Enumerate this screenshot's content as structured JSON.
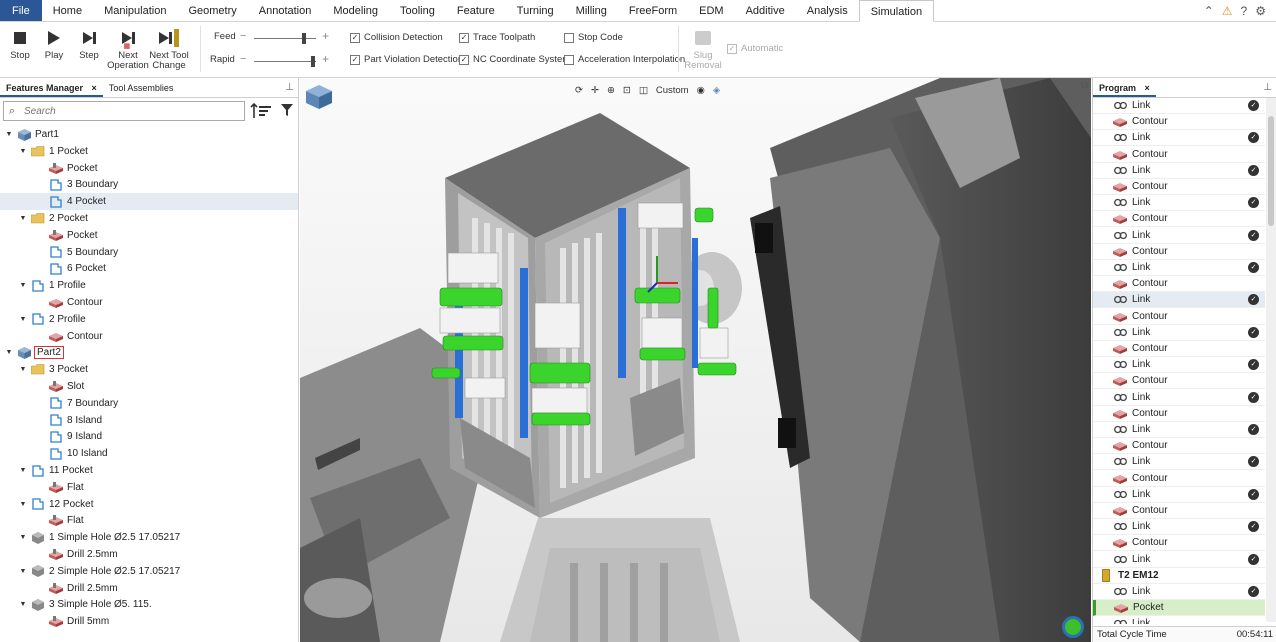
{
  "menu": {
    "file": "File",
    "tabs": [
      "Home",
      "Manipulation",
      "Geometry",
      "Annotation",
      "Modeling",
      "Tooling",
      "Feature",
      "Turning",
      "Milling",
      "FreeForm",
      "EDM",
      "Additive",
      "Analysis",
      "Simulation"
    ],
    "active": "Simulation"
  },
  "ribbon": {
    "stop": "Stop",
    "play": "Play",
    "step": "Step",
    "next_op": "Next Operation",
    "next_tool": "Next Tool Change",
    "feed_label": "Feed",
    "rapid_label": "Rapid",
    "feed_level": 0.78,
    "rapid_level": 0.92,
    "checks": [
      {
        "label": "Collision Detection",
        "checked": true
      },
      {
        "label": "Part Violation Detection",
        "checked": true
      },
      {
        "label": "Trace Toolpath",
        "checked": true
      },
      {
        "label": "NC Coordinate System",
        "checked": true
      },
      {
        "label": "Stop Code",
        "checked": false
      },
      {
        "label": "Acceleration Interpolation",
        "checked": false
      }
    ],
    "slug": "Slug Removal",
    "automatic": "Automatic"
  },
  "left": {
    "tab1": "Features Manager",
    "tab2": "Tool Assemblies",
    "search_placeholder": "Search",
    "tree": [
      {
        "label": "Part1",
        "level": 0,
        "icon": "part",
        "exp": "open"
      },
      {
        "label": "1 Pocket",
        "level": 1,
        "icon": "folder",
        "exp": "open"
      },
      {
        "label": "Pocket",
        "level": 2,
        "icon": "pocket-op"
      },
      {
        "label": "3 Boundary",
        "level": 2,
        "icon": "boundary"
      },
      {
        "label": "4 Pocket",
        "level": 2,
        "icon": "boundary",
        "selected": true
      },
      {
        "label": "2 Pocket",
        "level": 1,
        "icon": "folder",
        "exp": "open"
      },
      {
        "label": "Pocket",
        "level": 2,
        "icon": "pocket-op"
      },
      {
        "label": "5 Boundary",
        "level": 2,
        "icon": "boundary"
      },
      {
        "label": "6 Pocket",
        "level": 2,
        "icon": "boundary"
      },
      {
        "label": "1 Profile",
        "level": 1,
        "icon": "boundary",
        "exp": "open"
      },
      {
        "label": "Contour",
        "level": 2,
        "icon": "contour-op"
      },
      {
        "label": "2 Profile",
        "level": 1,
        "icon": "boundary",
        "exp": "open"
      },
      {
        "label": "Contour",
        "level": 2,
        "icon": "contour-op"
      },
      {
        "label": "Part2",
        "level": 0,
        "icon": "part",
        "exp": "open",
        "boxed": true
      },
      {
        "label": "3 Pocket",
        "level": 1,
        "icon": "folder",
        "exp": "open"
      },
      {
        "label": "Slot",
        "level": 2,
        "icon": "pocket-op"
      },
      {
        "label": "7 Boundary",
        "level": 2,
        "icon": "boundary"
      },
      {
        "label": "8 Island",
        "level": 2,
        "icon": "boundary"
      },
      {
        "label": "9 Island",
        "level": 2,
        "icon": "boundary"
      },
      {
        "label": "10 Island",
        "level": 2,
        "icon": "boundary"
      },
      {
        "label": "11 Pocket",
        "level": 1,
        "icon": "boundary",
        "exp": "open"
      },
      {
        "label": "Flat",
        "level": 2,
        "icon": "pocket-op"
      },
      {
        "label": "12 Pocket",
        "level": 1,
        "icon": "boundary",
        "exp": "open"
      },
      {
        "label": "Flat",
        "level": 2,
        "icon": "pocket-op"
      },
      {
        "label": "1 Simple Hole Ø2.5 17.05217",
        "level": 1,
        "icon": "hole",
        "exp": "open"
      },
      {
        "label": "Drill 2.5mm",
        "level": 2,
        "icon": "pocket-op"
      },
      {
        "label": "2 Simple Hole Ø2.5 17.05217",
        "level": 1,
        "icon": "hole",
        "exp": "open"
      },
      {
        "label": "Drill 2.5mm",
        "level": 2,
        "icon": "pocket-op"
      },
      {
        "label": "3 Simple Hole Ø5. 115.",
        "level": 1,
        "icon": "hole",
        "exp": "open"
      },
      {
        "label": "Drill 5mm",
        "level": 2,
        "icon": "pocket-op"
      }
    ]
  },
  "viewport": {
    "view_mode": "Custom"
  },
  "right": {
    "tab": "Program",
    "rows": [
      {
        "label": "Link",
        "type": "link",
        "check": true
      },
      {
        "label": "Contour",
        "type": "contour"
      },
      {
        "label": "Link",
        "type": "link",
        "check": true
      },
      {
        "label": "Contour",
        "type": "contour"
      },
      {
        "label": "Link",
        "type": "link",
        "check": true
      },
      {
        "label": "Contour",
        "type": "contour"
      },
      {
        "label": "Link",
        "type": "link",
        "check": true
      },
      {
        "label": "Contour",
        "type": "contour"
      },
      {
        "label": "Link",
        "type": "link",
        "check": true
      },
      {
        "label": "Contour",
        "type": "contour"
      },
      {
        "label": "Link",
        "type": "link",
        "check": true
      },
      {
        "label": "Contour",
        "type": "contour"
      },
      {
        "label": "Link",
        "type": "link",
        "check": true,
        "selected": true
      },
      {
        "label": "Contour",
        "type": "contour"
      },
      {
        "label": "Link",
        "type": "link",
        "check": true
      },
      {
        "label": "Contour",
        "type": "contour"
      },
      {
        "label": "Link",
        "type": "link",
        "check": true
      },
      {
        "label": "Contour",
        "type": "contour"
      },
      {
        "label": "Link",
        "type": "link",
        "check": true
      },
      {
        "label": "Contour",
        "type": "contour"
      },
      {
        "label": "Link",
        "type": "link",
        "check": true
      },
      {
        "label": "Contour",
        "type": "contour"
      },
      {
        "label": "Link",
        "type": "link",
        "check": true
      },
      {
        "label": "Contour",
        "type": "contour"
      },
      {
        "label": "Link",
        "type": "link",
        "check": true
      },
      {
        "label": "Contour",
        "type": "contour"
      },
      {
        "label": "Link",
        "type": "link",
        "check": true
      },
      {
        "label": "Contour",
        "type": "contour"
      },
      {
        "label": "Link",
        "type": "link",
        "check": true
      },
      {
        "label": "T2 EM12",
        "type": "tool",
        "top": true
      },
      {
        "label": "Link",
        "type": "link",
        "check": true
      },
      {
        "label": "Pocket",
        "type": "contour",
        "highlight": true
      },
      {
        "label": "Link",
        "type": "link"
      }
    ],
    "status_label": "Total Cycle Time",
    "status_value": "00:54:11"
  }
}
